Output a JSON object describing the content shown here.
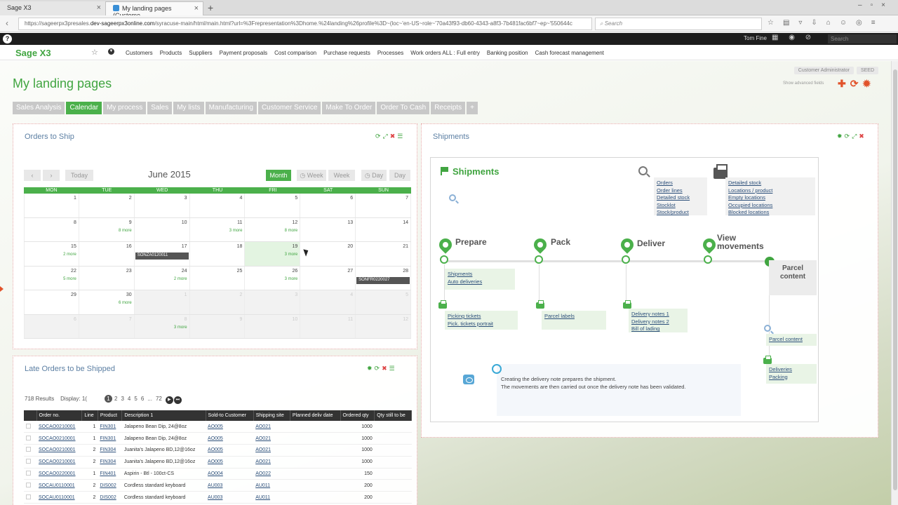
{
  "browser": {
    "tabs": [
      "Sage X3",
      "My landing pages (Custome..."
    ],
    "url_prefix": "https://sageerpx3presales.",
    "url_domain": "dev-sageerpx3online.com",
    "url_rest": "/syracuse-main/html/main.html?url=%3Frepresentation%3Dhome.%24landing%26profile%3D~(loc~'en-US~role~'70a43f93-db60-4343-a8f3-7b481fac6bf7~ep~'550644c",
    "search_placeholder": "Search"
  },
  "sagebar": {
    "help": "?",
    "user": "Tom Fine",
    "search_placeholder": "Search"
  },
  "appnav": {
    "logo": "Sage X3",
    "menu": [
      "Customers",
      "Products",
      "Suppliers",
      "Payment proposals",
      "Cost comparison",
      "Purchase requests",
      "Processes",
      "Work orders ALL : Full entry",
      "Banking position",
      "Cash forecast management"
    ]
  },
  "page": {
    "title": "My landing pages",
    "role": "Customer Administrator",
    "folder": "SEED",
    "show_advanced": "Show advanced fields",
    "tabs": [
      "Sales Analysis",
      "Calendar",
      "My process",
      "Sales",
      "My lists",
      "Manufacturing",
      "Customer Service",
      "Make To Order",
      "Order To Cash",
      "Receipts",
      "+"
    ],
    "active_tab": "Calendar"
  },
  "orders_to_ship": {
    "title": "Orders to Ship",
    "today": "Today",
    "month_title": "June 2015",
    "views": [
      "Month",
      "Week",
      "Week",
      "Day",
      "Day"
    ],
    "days": [
      "MON",
      "TUE",
      "WED",
      "THU",
      "FRI",
      "SAT",
      "SUN"
    ],
    "weeks": [
      [
        {
          "d": "1"
        },
        {
          "d": "2"
        },
        {
          "d": "3"
        },
        {
          "d": "4"
        },
        {
          "d": "5"
        },
        {
          "d": "6"
        },
        {
          "d": "7"
        }
      ],
      [
        {
          "d": "8"
        },
        {
          "d": "9",
          "more": "8 more"
        },
        {
          "d": "10"
        },
        {
          "d": "11",
          "more": "3 more"
        },
        {
          "d": "12",
          "more": "8 more"
        },
        {
          "d": "13"
        },
        {
          "d": "14"
        }
      ],
      [
        {
          "d": "15",
          "more": "2 more"
        },
        {
          "d": "16"
        },
        {
          "d": "17",
          "ev": "SONZA0120011"
        },
        {
          "d": "18"
        },
        {
          "d": "19",
          "more": "3 more",
          "today": true
        },
        {
          "d": "20"
        },
        {
          "d": "21"
        }
      ],
      [
        {
          "d": "22",
          "more": "5 more"
        },
        {
          "d": "23"
        },
        {
          "d": "24",
          "more": "2 more"
        },
        {
          "d": "25"
        },
        {
          "d": "26",
          "more": "3 more"
        },
        {
          "d": "27"
        },
        {
          "d": "28",
          "ev": "SONFR0220027"
        }
      ],
      [
        {
          "d": "29"
        },
        {
          "d": "30",
          "more": "6 more"
        },
        {
          "d": "1",
          "grey": true
        },
        {
          "d": "2",
          "grey": true
        },
        {
          "d": "3",
          "grey": true
        },
        {
          "d": "4",
          "grey": true
        },
        {
          "d": "5",
          "grey": true
        }
      ],
      [
        {
          "d": "6",
          "grey": true
        },
        {
          "d": "7",
          "grey": true
        },
        {
          "d": "8",
          "grey": true,
          "more": "3 more"
        },
        {
          "d": "9",
          "grey": true
        },
        {
          "d": "10",
          "grey": true
        },
        {
          "d": "11",
          "grey": true
        },
        {
          "d": "12",
          "grey": true
        }
      ]
    ]
  },
  "late_orders": {
    "title": "Late Orders to be Shipped",
    "results": "718 Results",
    "display": "Display:",
    "display_value": "1(",
    "pages": [
      "1",
      "2",
      "3",
      "4",
      "5",
      "6",
      "...",
      "72"
    ],
    "columns": [
      "Order no.",
      "Line",
      "Product",
      "Description 1",
      "Sold-to Customer",
      "Shipping site",
      "Planned deliv date",
      "Ordered qty",
      "Qty still to be"
    ],
    "rows": [
      [
        "SOCAO0210001",
        "1",
        "FIN301",
        "Jalapeno Bean Dip, 24@8oz",
        "AO005",
        "AO021",
        "",
        "1000",
        ""
      ],
      [
        "SOCAO0210001",
        "1",
        "FIN301",
        "Jalapeno Bean Dip, 24@8oz",
        "AO005",
        "AO021",
        "",
        "1000",
        ""
      ],
      [
        "SOCAO0210001",
        "2",
        "FIN304",
        "Juanita's Jalapeno BD,12@16oz",
        "AO005",
        "AO021",
        "",
        "1000",
        ""
      ],
      [
        "SOCAO0210001",
        "2",
        "FIN304",
        "Juanita's Jalapeno BD,12@16oz",
        "AO005",
        "AO021",
        "",
        "1000",
        ""
      ],
      [
        "SOCAO0220001",
        "1",
        "FIN401",
        "Aspirin - Btl - 100ct-CS",
        "AO004",
        "AO022",
        "",
        "150",
        ""
      ],
      [
        "SOCAU0110001",
        "2",
        "DIS002",
        "Cordless standard keyboard",
        "AU003",
        "AU011",
        "",
        "200",
        ""
      ],
      [
        "SOCAU0110001",
        "2",
        "DIS002",
        "Cordless standard keyboard",
        "AU003",
        "AU011",
        "",
        "200",
        ""
      ]
    ]
  },
  "shipments": {
    "panel_title": "Shipments",
    "heading": "Shipments",
    "orders_links": [
      "Orders",
      "Order lines",
      "Detailed stock",
      "Stocklot",
      "Stock/product"
    ],
    "stock_links": [
      "Detailed stock",
      "Locations / product",
      "Empty locations",
      "Occupied locations",
      "Blocked locations"
    ],
    "steps": [
      "Prepare",
      "Pack",
      "Deliver",
      "View movements"
    ],
    "parcel_content_step": "Parcel content",
    "prepare_links": [
      "Shipments",
      "Auto deliveries"
    ],
    "prepare_print_links": [
      "Picking tickets",
      "Pick. tickets portrait"
    ],
    "pack_print_links": [
      "Parcel labels"
    ],
    "deliver_print_links": [
      "Delivery notes 1",
      "Delivery notes 2",
      "Bill of lading"
    ],
    "parcel_links": [
      "Parcel content"
    ],
    "deliveries_links": [
      "Deliveries",
      "Packing"
    ],
    "note_line1": "Creating the delivery note prepares the shipment.",
    "note_line2": "The movements are then carried out once the delivery note has been validated."
  }
}
